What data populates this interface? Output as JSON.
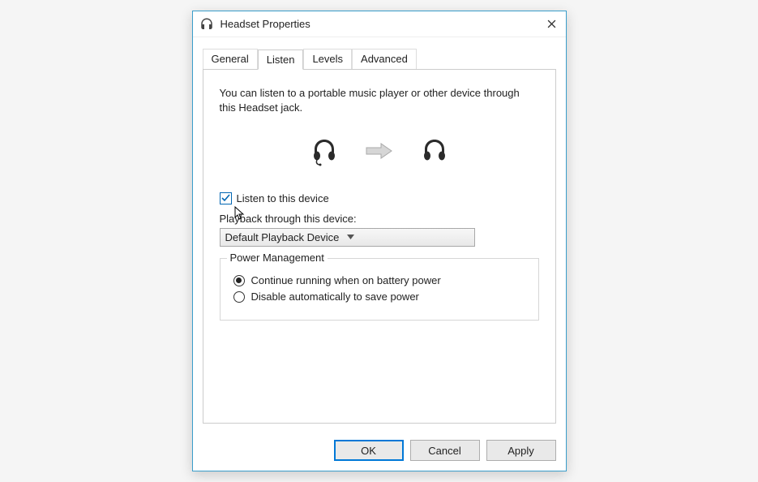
{
  "titlebar": {
    "title": "Headset Properties"
  },
  "tabs": {
    "general": "General",
    "listen": "Listen",
    "levels": "Levels",
    "advanced": "Advanced"
  },
  "panel": {
    "description": "You can listen to a portable music player or other device through this Headset jack.",
    "listen_checkbox_label": "Listen to this device",
    "listen_checkbox_checked": true,
    "playback_label": "Playback through this device:",
    "playback_selected": "Default Playback Device",
    "power_management": {
      "legend": "Power Management",
      "option_continue": "Continue running when on battery power",
      "option_disable": "Disable automatically to save power",
      "selected": "continue"
    }
  },
  "buttons": {
    "ok": "OK",
    "cancel": "Cancel",
    "apply": "Apply"
  }
}
